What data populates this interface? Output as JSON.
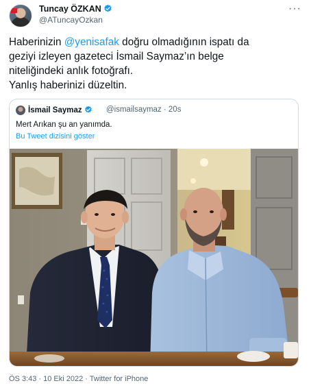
{
  "tweet": {
    "author_name": "Tuncay ÖZKAN",
    "author_handle": "@ATuncayOzkan",
    "more_icon": "more-icon",
    "text_parts": {
      "l1_a": "Haberinizin ",
      "mention": "@yenisafak",
      "l1_b": " doğru olmadığının ispatı da",
      "line2": "geziyi izleyen gazeteci İsmail Saymaz’ın belge",
      "line3": "niteliğindeki anlık fotoğrafı.",
      "line4": "Yanlış haberinizi düzeltin."
    },
    "footer": "ÖS 3:43 · 10 Eki 2022 · Twitter for iPhone"
  },
  "quoted": {
    "author_name": "İsmail Saymaz",
    "author_handle": "@ismailsaymaz · 20s",
    "text": "Mert Arıkan şu an yanımda.",
    "thread_link": "Bu Tweet dizisini göster"
  },
  "colors": {
    "accent": "#1d9bf0",
    "text": "#0f1419",
    "muted": "#536471",
    "border": "#cfd9de"
  }
}
